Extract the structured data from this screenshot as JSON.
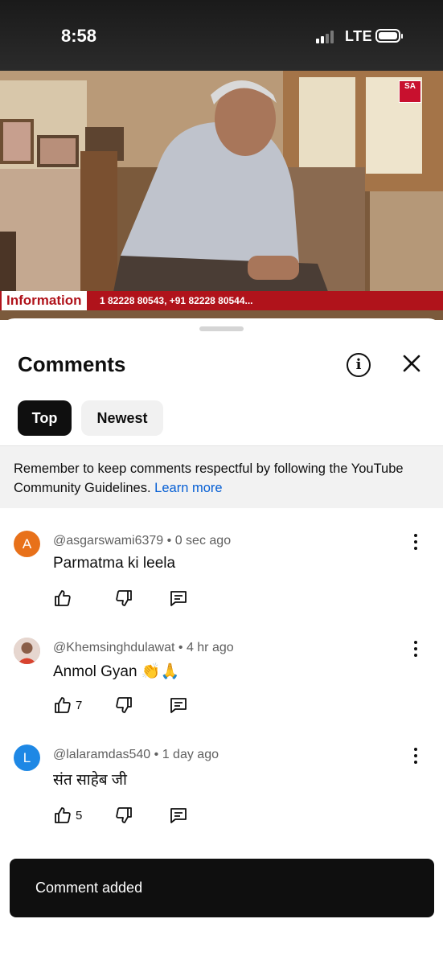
{
  "status_bar": {
    "time": "8:58",
    "network": "LTE"
  },
  "video": {
    "channel_logo": "SA",
    "ticker_label": "Information",
    "ticker_text": "1 82228 80543, +91 82228 80544..."
  },
  "comments_panel": {
    "title": "Comments",
    "info_icon": "info-icon",
    "close_icon": "close-icon",
    "tabs": [
      {
        "label": "Top",
        "selected": true
      },
      {
        "label": "Newest",
        "selected": false
      }
    ],
    "notice": {
      "text": "Remember to keep comments respectful by following the YouTube Community Guidelines.",
      "link": "Learn more"
    },
    "comments": [
      {
        "avatar_letter": "A",
        "avatar_color": "#e8711a",
        "author": "@asgarswami6379",
        "time": "0 sec ago",
        "text": "Parmatma ki leela",
        "likes": ""
      },
      {
        "avatar_letter": "",
        "avatar_color": "#c9a89a",
        "author": "@Khemsinghdulawat",
        "time": "4 hr ago",
        "text": "Anmol Gyan 👏🙏",
        "likes": "7"
      },
      {
        "avatar_letter": "L",
        "avatar_color": "#1e88e5",
        "author": "@lalaramdas540",
        "time": "1 day ago",
        "text": "संत साहेब जी",
        "likes": "5"
      }
    ]
  },
  "toast": {
    "text": "Comment added"
  },
  "colors": {
    "accent_link": "#065fd4",
    "ticker_red": "#b0131b",
    "chip_active": "#0f0f0f"
  }
}
